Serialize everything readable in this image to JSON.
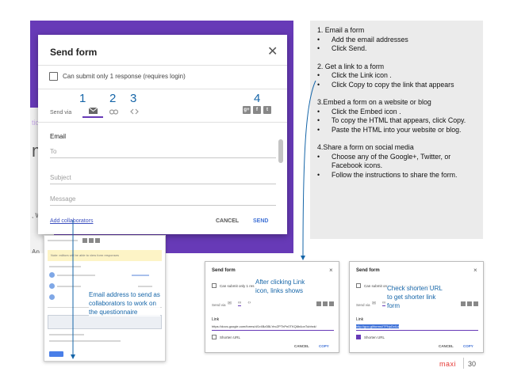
{
  "bg": {
    "t1": "tio",
    "t2": "m",
    "t3": ", W",
    "t4": "Ap"
  },
  "dialog": {
    "title": "Send form",
    "close": "✕",
    "checkbox_label": "Can submit only 1 response (requires login)",
    "send_via": "Send via",
    "numbers": [
      "1",
      "2",
      "3",
      "4"
    ],
    "email_label": "Email",
    "to_placeholder": "To",
    "subject_placeholder": "Subject",
    "message_placeholder": "Message",
    "add_collaborators": "Add collaborators",
    "cancel": "CANCEL",
    "send": "SEND",
    "social": [
      "g+",
      "f",
      "t"
    ]
  },
  "collab": {
    "notice": "Note: editors will be able to view form responses",
    "callout": "Email address to send as collaborators to work on the questionnaire"
  },
  "instructions": {
    "s1_title": "1. Email a form",
    "s1_b1": "Add the email addresses",
    "s1_b2": "Click Send.",
    "s2_title": "2. Get a link to a form",
    "s2_b1": "Click the Link icon .",
    "s2_b2": "Click Copy to copy the link that appears",
    "s3_title": "3.Embed a form on a website or blog",
    "s3_b1": "Click the Embed icon .",
    "s3_b2": "To copy the HTML that appears, click Copy.",
    "s3_b3": "Paste the HTML into your website or blog.",
    "s4_title": "4.Share a form on social media",
    "s4_b1": "Choose any of the Google+, Twitter, or Facebook icons.",
    "s4_b2": "Follow the instructions to share the form.",
    "bullet": "•"
  },
  "mini1": {
    "title": "Send form",
    "chk": "Can submit only 1 res",
    "send_via": "Send via",
    "link": "Link",
    "url": "https://docs.google.com/forms/d/1r4Bz3BLYecZPThPn0TKQ6b4onTubhxk/",
    "shorten": "Shorten URL",
    "cancel": "CANCEL",
    "copy": "COPY",
    "callout": "After clicking Link icon, links shows"
  },
  "mini2": {
    "title": "Send form",
    "chk": "Can submit only 1 response (requires login)",
    "send_via": "Send via",
    "link": "Link",
    "url": "http://goo.gl/forms/iTFNpDvlLd",
    "shorten": "Shorten URL",
    "cancel": "CANCEL",
    "copy": "COPY",
    "callout": "Check shorten URL to get shorter link form"
  },
  "footer": {
    "logo": "maxi",
    "page": "30"
  }
}
